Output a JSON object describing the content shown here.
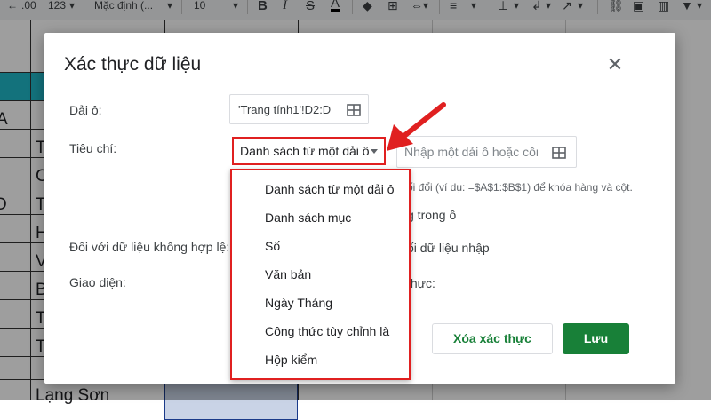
{
  "toolbar": {
    "format_decimal": ".00",
    "format_more": "123",
    "font_name": "Mặc định (...",
    "font_size": "10",
    "bold": "B",
    "italic": "I",
    "strike": "S",
    "text_color": "A"
  },
  "sheet": {
    "cells": [
      "A",
      "T",
      "C",
      "D",
      "T",
      "H",
      "V",
      "B",
      "T",
      "T",
      "Lạng Sơn"
    ]
  },
  "dialog": {
    "title": "Xác thực dữ liệu",
    "range_label": "Dải ô:",
    "range_value": "'Trang tính1'!D2:D",
    "criteria_label": "Tiêu chí:",
    "criteria_selected": "Danh sách từ một dải ô",
    "range_input_placeholder": "Nhập một dải ô hoặc côn",
    "hint_text": "ối đổi (ví dụ: =$A$1:$B$1) để khóa hàng và cột.",
    "checkbox_text": "g trong ô",
    "invalid_label": "Đối với dữ liệu không hợp lệ:",
    "invalid_option": "ối dữ liệu nhập",
    "appearance_label": "Giao diện:",
    "appearance_option": "thực:",
    "remove_button": "Xóa xác thực",
    "save_button": "Lưu"
  },
  "menu": {
    "items": [
      "Danh sách từ một dải ô",
      "Danh sách mục",
      "Số",
      "Văn bản",
      "Ngày Tháng",
      "Công thức tùy chỉnh là",
      "Hộp kiểm"
    ]
  },
  "colors": {
    "header_cyan": "#1fb8c9",
    "highlight_red": "#e02020",
    "save_green": "#188038"
  }
}
